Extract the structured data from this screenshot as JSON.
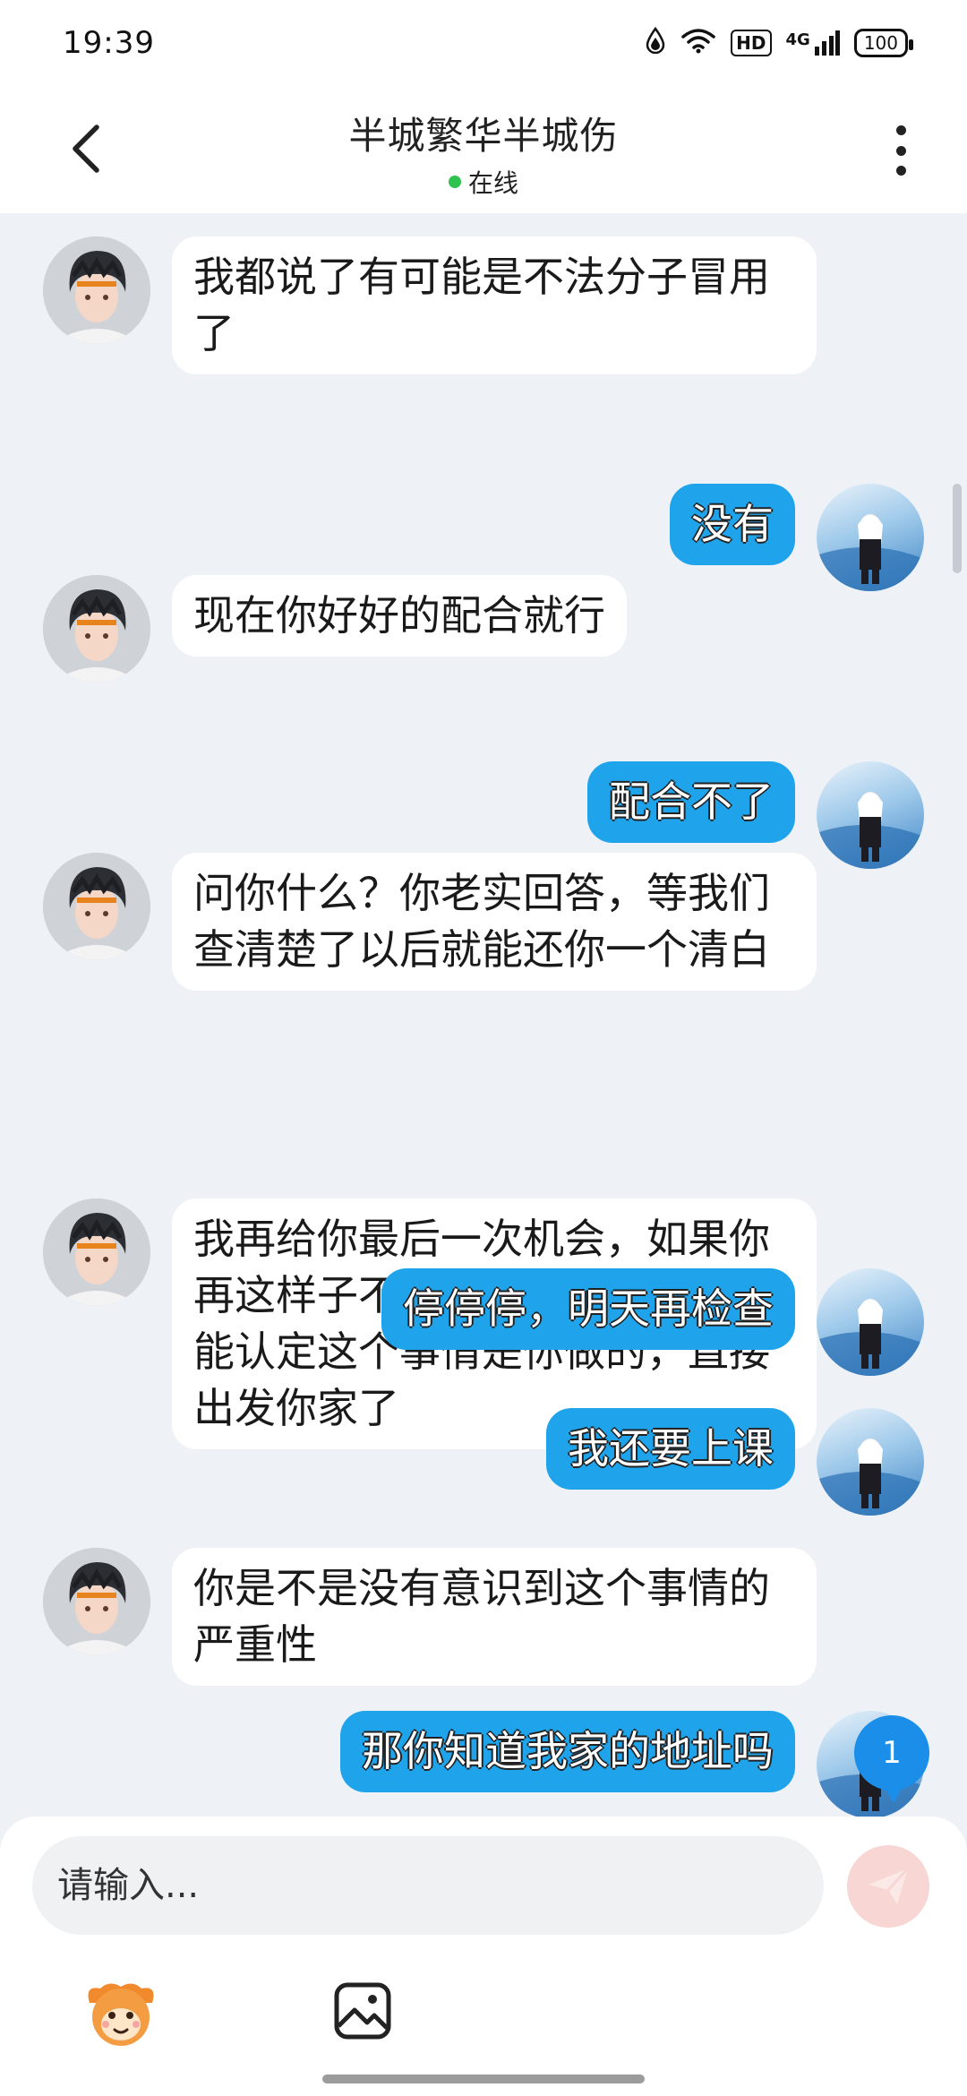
{
  "status_bar": {
    "time": "19:39",
    "battery": "100",
    "network": "4G",
    "hd_label": "HD",
    "icons": [
      "data-saver-icon",
      "wifi-icon",
      "hd-icon",
      "signal-icon",
      "battery-icon"
    ]
  },
  "header": {
    "title": "半城繁华半城伤",
    "status": "在线",
    "status_color": "#2ec24f"
  },
  "messages": [
    {
      "side": "in",
      "text": "我都说了有可能是不法分子冒用了"
    },
    {
      "side": "out",
      "text": "没有"
    },
    {
      "side": "in",
      "text": "现在你好好的配合就行"
    },
    {
      "side": "out",
      "text": "配合不了"
    },
    {
      "side": "in",
      "text": "问你什么？你老实回答，等我们查清楚了以后就能还你一个清白"
    },
    {
      "side": "in",
      "text": "我再给你最后一次机会，如果你再这样子不好好的配合，那我只能认定这个事情是你做的，直接出发你家了"
    },
    {
      "side": "out",
      "text": "停停停，明天再检查"
    },
    {
      "side": "out",
      "text": "我还要上课"
    },
    {
      "side": "in",
      "text": "你是不是没有意识到这个事情的严重性"
    },
    {
      "side": "out",
      "text": "那你知道我家的地址吗"
    }
  ],
  "unread_count": "1",
  "input": {
    "placeholder": "请输入..."
  },
  "colors": {
    "outgoing_bubble": "#1fa4ec",
    "incoming_bubble": "#ffffff",
    "send_button": "#f7d6d3"
  }
}
